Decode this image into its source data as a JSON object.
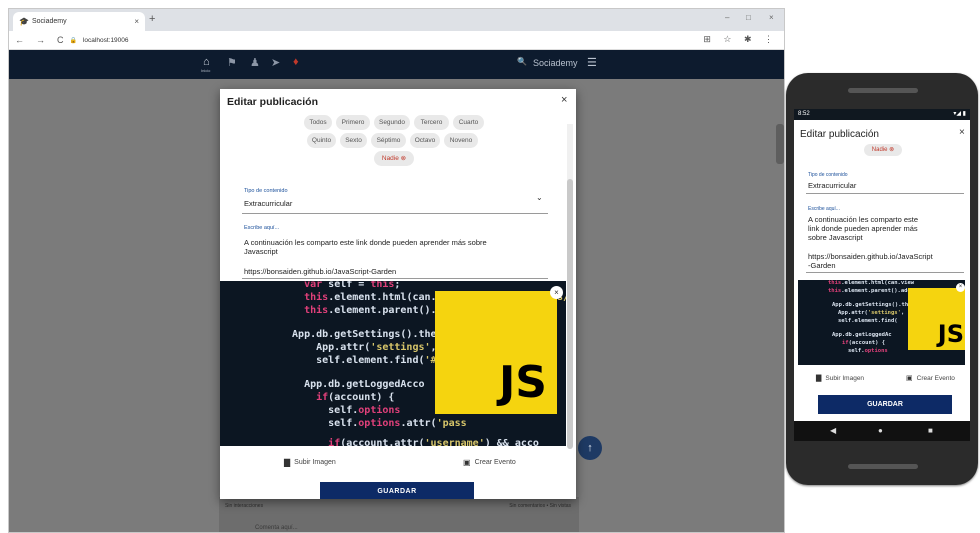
{
  "browser": {
    "tab_title": "Sociademy",
    "tab_close": "×",
    "new_tab": "+",
    "url": "localhost:19006",
    "nav": {
      "back": "←",
      "forward": "→",
      "reload": "C",
      "lock": "🔒"
    },
    "window_controls": {
      "minimize": "–",
      "maximize": "□",
      "close": "×"
    },
    "toolbar_icons": "⊞ ☆ ✱ ⋮"
  },
  "app": {
    "home_label": "Inicio",
    "brand": "Sociademy",
    "search_icon": "🔍",
    "menu_icon": "☰"
  },
  "background": {
    "interactions": "Sin interacciones",
    "comments": "Sin comentarios • Sin vistas",
    "comment_placeholder": "Comenta aquí..."
  },
  "dialog": {
    "title": "Editar publicación",
    "close": "×",
    "grades": [
      "Todos",
      "Primero",
      "Segundo",
      "Tercero",
      "Cuarto",
      "Quinto",
      "Sexto",
      "Séptimo",
      "Octavo",
      "Noveno"
    ],
    "none_chip": "Nadie",
    "content_type_label": "Tipo de contenido",
    "content_type_value": "Extracurricular",
    "text_label": "Escribe aquí...",
    "text_line1": "A continuación les comparto este link donde pueden aprender más sobre",
    "text_line2": "Javascript",
    "text_link": "https://bonsaiden.github.io/JavaScript-Garden",
    "image_logo": "JS",
    "upload_image": "Subir Imagen",
    "create_event": "Crear Evento",
    "save": "GUARDAR"
  },
  "phone": {
    "time": "8:52",
    "status_right": "▾◢ ▮",
    "title": "Editar publicación",
    "close": "×",
    "none_chip": "Nadie",
    "content_type_label": "Tipo de contenido",
    "content_type_value": "Extracurricular",
    "text_label": "Escribe aquí...",
    "text_line1": "A continuación les comparto este",
    "text_line2": "link donde pueden aprender más",
    "text_line3": "sobre Javascript",
    "link_line1": "https://bonsaiden.github.io/JavaScript",
    "link_line2": "-Garden",
    "image_logo": "JS",
    "upload_image": "Subir Imagen",
    "create_event": "Crear Evento",
    "save": "GUARDAR",
    "nav": {
      "back": "◀",
      "home": "●",
      "recent": "■"
    }
  },
  "colors": {
    "navbar": "#0d1b2e",
    "save_button": "#0d2a66",
    "js_yellow": "#f5d40f",
    "label_blue": "#1a4f9a",
    "chip_red": "#c0392b"
  }
}
